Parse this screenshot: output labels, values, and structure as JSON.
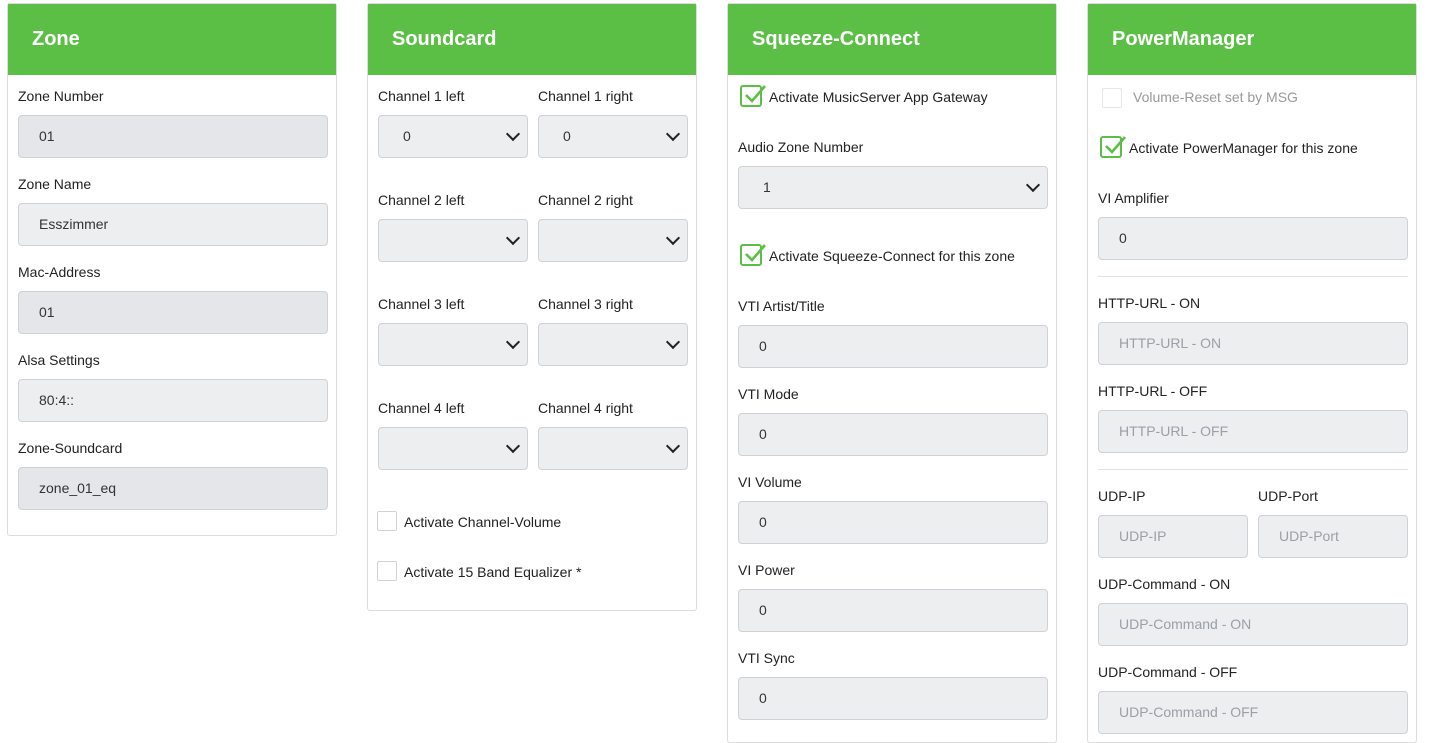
{
  "zone": {
    "title": "Zone",
    "zone_number_label": "Zone Number",
    "zone_number_value": "01",
    "zone_name_label": "Zone Name",
    "zone_name_value": "Esszimmer",
    "mac_label": "Mac-Address",
    "mac_value": "01",
    "alsa_label": "Alsa Settings",
    "alsa_value": "80:4::",
    "soundcard_label": "Zone-Soundcard",
    "soundcard_value": "zone_01_eq"
  },
  "soundcard": {
    "title": "Soundcard",
    "ch1_left_label": "Channel 1 left",
    "ch1_right_label": "Channel 1 right",
    "ch1_left_value": "0",
    "ch1_right_value": "0",
    "ch2_left_label": "Channel 2 left",
    "ch2_right_label": "Channel 2 right",
    "ch2_left_value": "",
    "ch2_right_value": "",
    "ch3_left_label": "Channel 3 left",
    "ch3_right_label": "Channel 3 right",
    "ch3_left_value": "",
    "ch3_right_value": "",
    "ch4_left_label": "Channel 4 left",
    "ch4_right_label": "Channel 4 right",
    "ch4_left_value": "",
    "ch4_right_value": "",
    "channel_volume_label": "Activate Channel-Volume",
    "equalizer_label": "Activate 15 Band Equalizer *"
  },
  "squeeze": {
    "title": "Squeeze-Connect",
    "gateway_label": "Activate MusicServer App Gateway",
    "audio_zone_label": "Audio Zone Number",
    "audio_zone_value": "1",
    "activate_label": "Activate Squeeze-Connect for this zone",
    "vti_artist_label": "VTI Artist/Title",
    "vti_artist_value": "0",
    "vti_mode_label": "VTI Mode",
    "vti_mode_value": "0",
    "vi_volume_label": "VI Volume",
    "vi_volume_value": "0",
    "vi_power_label": "VI Power",
    "vi_power_value": "0",
    "vti_sync_label": "VTI Sync",
    "vti_sync_value": "0"
  },
  "power": {
    "title": "PowerManager",
    "volume_reset_label": "Volume-Reset set by MSG",
    "activate_label": "Activate PowerManager for this zone",
    "vi_amp_label": "VI Amplifier",
    "vi_amp_value": "0",
    "http_on_label": "HTTP-URL - ON",
    "http_on_placeholder": "HTTP-URL - ON",
    "http_off_label": "HTTP-URL - OFF",
    "http_off_placeholder": "HTTP-URL - OFF",
    "udp_ip_label": "UDP-IP",
    "udp_ip_placeholder": "UDP-IP",
    "udp_port_label": "UDP-Port",
    "udp_port_placeholder": "UDP-Port",
    "udp_cmd_on_label": "UDP-Command - ON",
    "udp_cmd_on_placeholder": "UDP-Command - ON",
    "udp_cmd_off_label": "UDP-Command - OFF",
    "udp_cmd_off_placeholder": "UDP-Command - OFF"
  },
  "colors": {
    "accent": "#5bbf45",
    "field_bg": "#eceef0"
  },
  "icons": {
    "select": "chevron-down-icon",
    "checked": "check-icon"
  }
}
